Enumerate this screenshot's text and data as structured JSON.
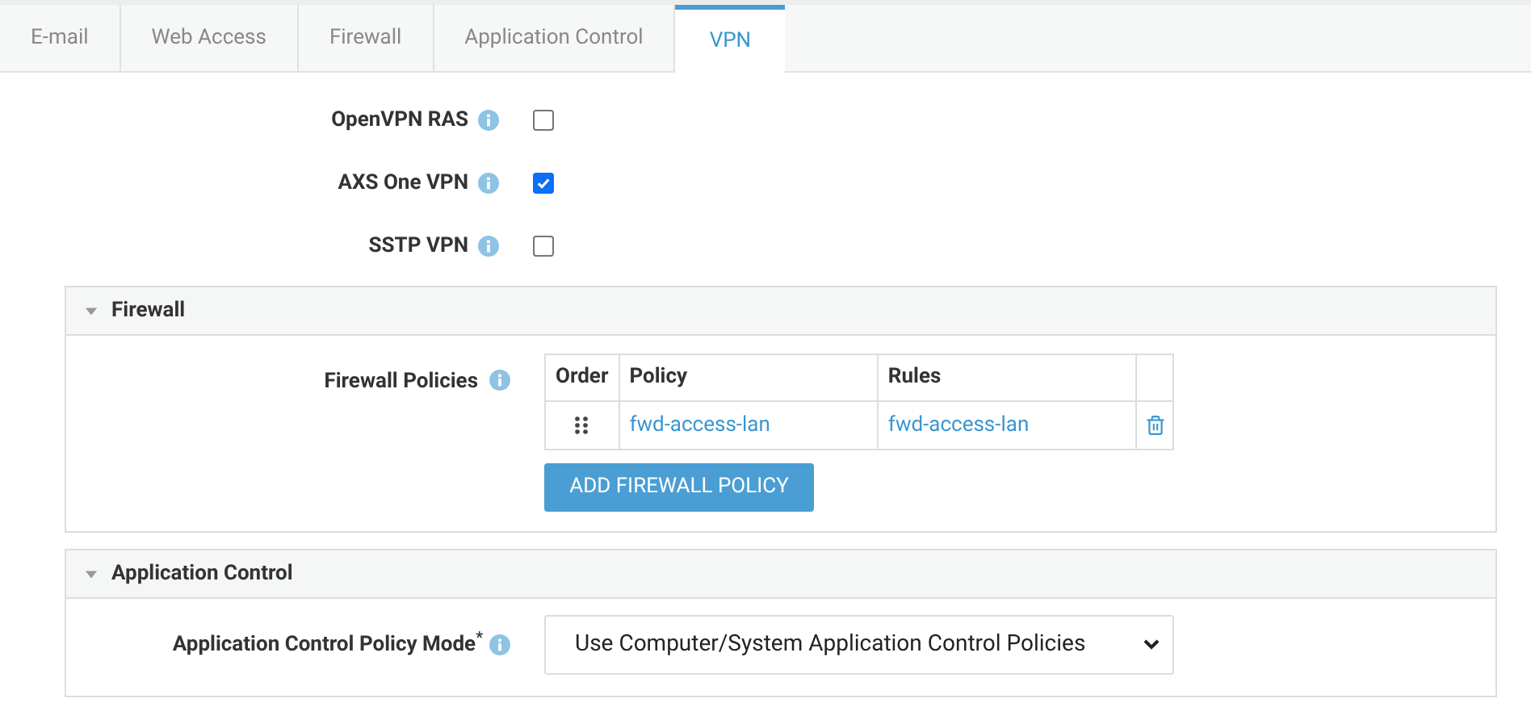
{
  "tabs": [
    {
      "label": "E-mail",
      "selected": false
    },
    {
      "label": "Web Access",
      "selected": false
    },
    {
      "label": "Firewall",
      "selected": false
    },
    {
      "label": "Application Control",
      "selected": false
    },
    {
      "label": "VPN",
      "selected": true
    }
  ],
  "vpn_options": [
    {
      "label": "OpenVPN RAS",
      "checked": false
    },
    {
      "label": "AXS One VPN",
      "checked": true
    },
    {
      "label": "SSTP VPN",
      "checked": false
    }
  ],
  "firewall_section": {
    "title": "Firewall",
    "expanded": true,
    "field_label": "Firewall Policies",
    "table": {
      "columns": [
        "Order",
        "Policy",
        "Rules"
      ],
      "rows": [
        {
          "policy": "fwd-access-lan",
          "rules": "fwd-access-lan"
        }
      ]
    },
    "add_button": "ADD FIREWALL POLICY"
  },
  "application_control_section": {
    "title": "Application Control",
    "expanded": true,
    "field_label": "Application Control Policy Mode$^{*}$",
    "select_value": "Use Computer/System Application Control Policies"
  }
}
